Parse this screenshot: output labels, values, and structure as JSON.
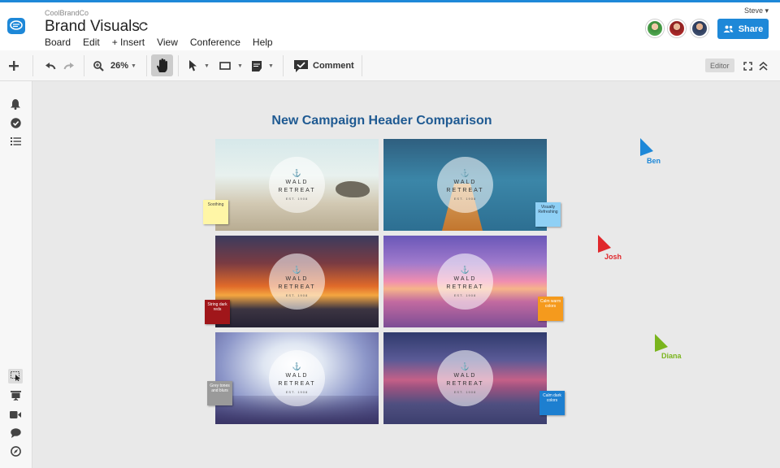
{
  "header": {
    "org": "CoolBrandCo",
    "title": "Brand Visuals",
    "user": "Steve ▾",
    "share_label": "Share",
    "menu": [
      "Board",
      "Edit",
      "+ Insert",
      "View",
      "Conference",
      "Help"
    ]
  },
  "toolbar": {
    "zoom": "26%",
    "comment_label": "Comment",
    "editor_label": "Editor"
  },
  "canvas": {
    "title": "New Campaign Header Comparison",
    "images": [
      {
        "brand_line1": "WALD",
        "brand_line2": "RETREAT",
        "est": "EST. 1908"
      },
      {
        "brand_line1": "WALD",
        "brand_line2": "RETREAT",
        "est": "EST. 1908"
      },
      {
        "brand_line1": "WALD",
        "brand_line2": "RETREAT",
        "est": "EST. 1908"
      },
      {
        "brand_line1": "WALD",
        "brand_line2": "RETREAT",
        "est": "EST. 1908"
      },
      {
        "brand_line1": "WALD",
        "brand_line2": "RETREAT",
        "est": "EST. 1908"
      },
      {
        "brand_line1": "WALD",
        "brand_line2": "RETREAT",
        "est": "EST. 1908"
      }
    ],
    "notes": [
      {
        "text": "Soothing",
        "color": "#fff6a6"
      },
      {
        "text": "Visually Refreshing",
        "color": "#8fd0f5"
      },
      {
        "text": "String dark reds",
        "color": "#a0161a"
      },
      {
        "text": "Calm warm colors",
        "color": "#f59a1d"
      },
      {
        "text": "Grey tones and blurs",
        "color": "#9a9a9a"
      },
      {
        "text": "Calm dark colors",
        "color": "#1d7fd0"
      }
    ],
    "cursors": [
      {
        "name": "Ben",
        "color": "#1e88d8"
      },
      {
        "name": "Josh",
        "color": "#e0282c"
      },
      {
        "name": "Diana",
        "color": "#7ab51d"
      }
    ]
  },
  "colors": {
    "accent": "#1e88d8"
  }
}
